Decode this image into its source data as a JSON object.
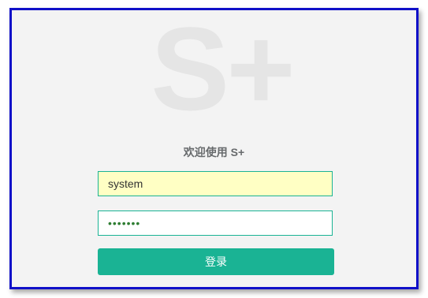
{
  "logo": {
    "text": "S+"
  },
  "welcome": {
    "text": "欢迎使用 S+"
  },
  "form": {
    "username_value": "system",
    "password_value": "•••••••",
    "login_label": "登录"
  },
  "colors": {
    "accent": "#1ab394",
    "frame_border": "#1010c8",
    "autofill_bg": "#ffffc4"
  }
}
